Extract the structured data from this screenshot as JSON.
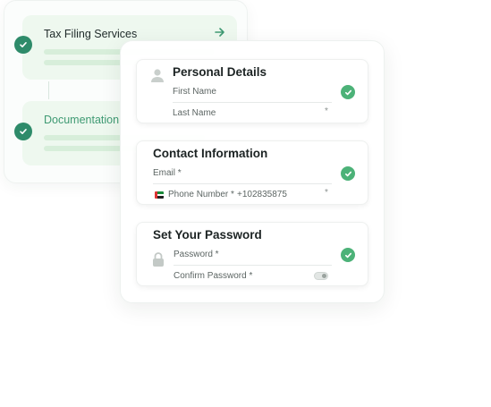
{
  "steps": [
    {
      "title": "Tax Filing Services",
      "state": "done"
    },
    {
      "title": "Documentation",
      "state": "active"
    }
  ],
  "personal": {
    "title": "Personal Details",
    "first_name": "First Name",
    "last_name": "Last Name",
    "required_mark": "*"
  },
  "contact": {
    "title": "Contact Information",
    "email": "Email *",
    "phone_label": "Phone Number *",
    "phone_value": "+102835875",
    "required_mark": "*"
  },
  "password": {
    "title": "Set Your Password",
    "password": "Password *",
    "confirm": "Confirm Password *"
  },
  "colors": {
    "accent": "#2e8b6a",
    "check_green": "#4cb278",
    "step_bg": "#eef8ef"
  }
}
